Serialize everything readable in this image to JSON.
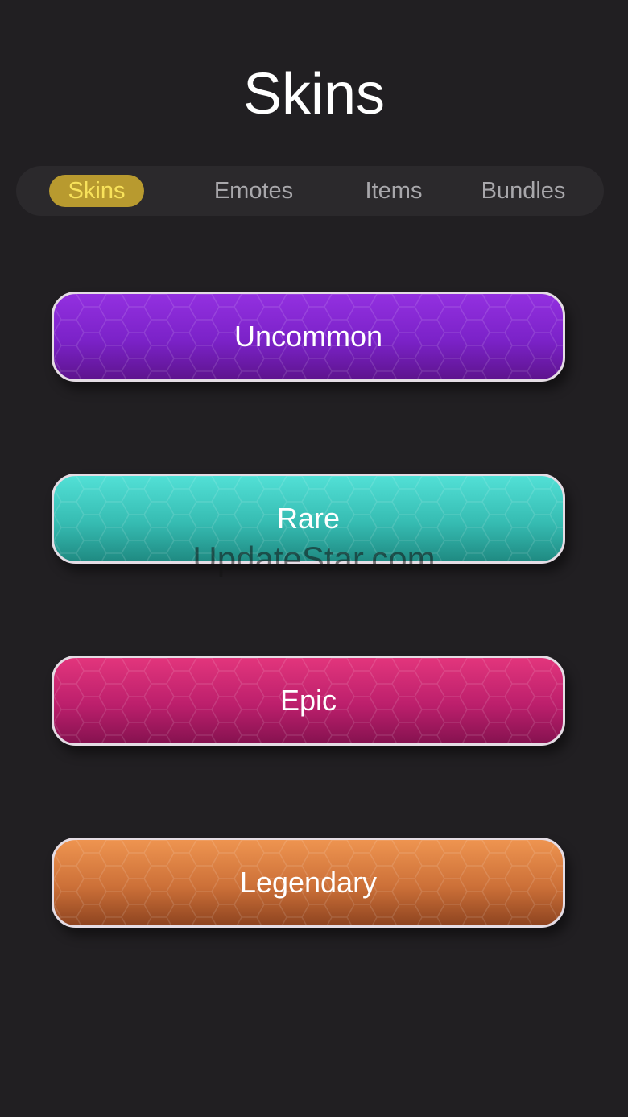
{
  "header": {
    "title": "Skins"
  },
  "tabs": [
    {
      "label": "Skins",
      "active": true
    },
    {
      "label": "Emotes",
      "active": false
    },
    {
      "label": "Items",
      "active": false
    },
    {
      "label": "Bundles",
      "active": false
    }
  ],
  "rarities": [
    {
      "label": "Uncommon",
      "color": "#7b22c8"
    },
    {
      "label": "Rare",
      "color": "#36bcb2"
    },
    {
      "label": "Epic",
      "color": "#bc1f6c"
    },
    {
      "label": "Legendary",
      "color": "#cc7038"
    }
  ],
  "watermark": "UpdateStar.com",
  "colors": {
    "background": "#211f22",
    "tab_active_bg": "#b89a2f",
    "tab_active_text": "#f8e25a",
    "tab_inactive_text": "#a8a7ab"
  }
}
